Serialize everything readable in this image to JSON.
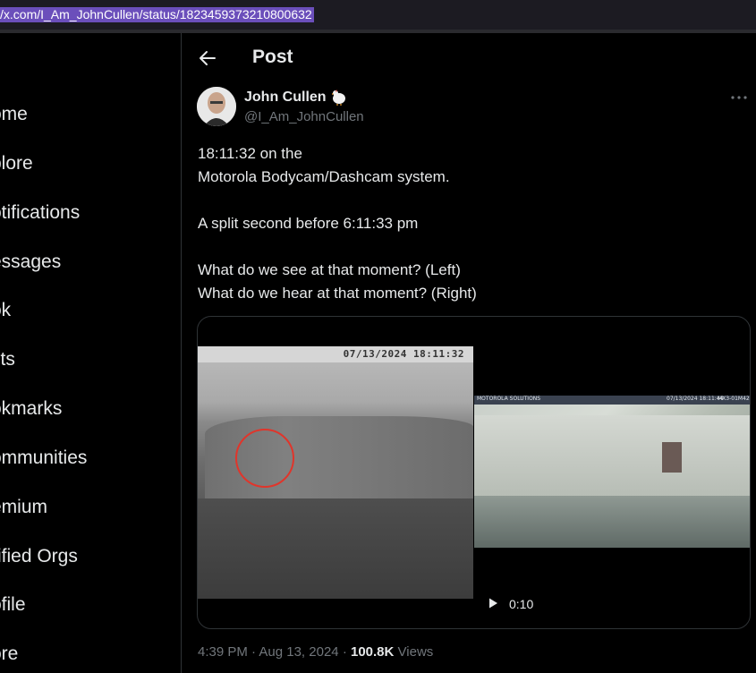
{
  "browser": {
    "url": "/x.com/I_Am_JohnCullen/status/1823459373210800632"
  },
  "sidebar": {
    "items": [
      {
        "label": "ome"
      },
      {
        "label": "plore"
      },
      {
        "label": "otifications"
      },
      {
        "label": "essages"
      },
      {
        "label": "ok"
      },
      {
        "label": "sts"
      },
      {
        "label": "okmarks"
      },
      {
        "label": "ommunities"
      },
      {
        "label": "emium"
      },
      {
        "label": "rified Orgs"
      },
      {
        "label": "ofile"
      },
      {
        "label": "ore"
      }
    ]
  },
  "header": {
    "title": "Post",
    "back_icon": "arrow-left-icon"
  },
  "post": {
    "author_name": "John Cullen",
    "author_emoji": "🐓",
    "author_handle": "@I_Am_JohnCullen",
    "more_icon": "more-horizontal-icon",
    "lines": [
      "18:11:32 on the",
      "Motorola Bodycam/Dashcam system.",
      "",
      "A split second before 6:11:33 pm",
      "",
      "What do we see at that moment? (Left)",
      "What do we hear at that moment? (Right)"
    ],
    "media": {
      "left_timestamp": "07/13/2024 18:11:32",
      "right_brand": "MOTOROLA SOLUTIONS",
      "right_timestamp": "07/13/2024 18:11:44",
      "right_id": "MX3-01M42",
      "duration": "0:10",
      "play_icon": "play-icon"
    },
    "time": "4:39 PM",
    "date": "Aug 13, 2024",
    "views_count": "100.8K",
    "views_label": "Views",
    "separator": "·"
  },
  "colors": {
    "background": "#000000",
    "text": "#e7e9ea",
    "muted": "#71767b",
    "border": "#2f3336",
    "url_highlight": "#6b4fbb",
    "circle": "#e0352b"
  }
}
